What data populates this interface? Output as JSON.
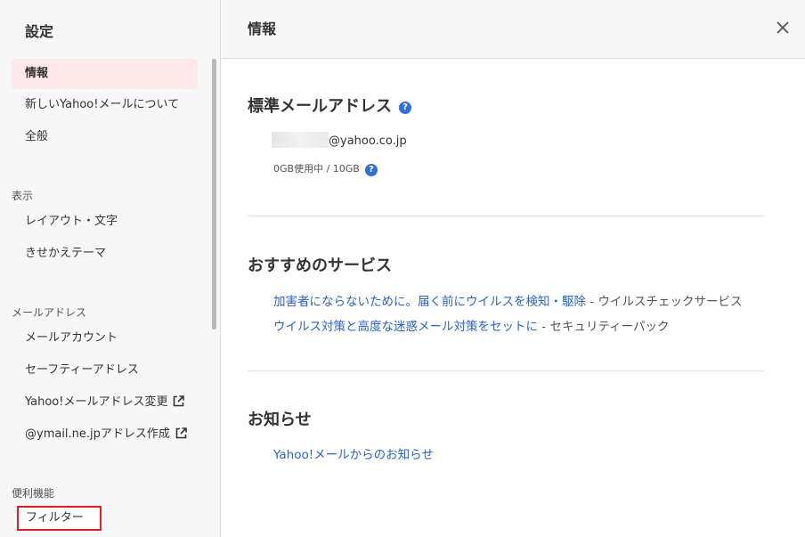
{
  "sidebar": {
    "title": "設定",
    "items_top": [
      {
        "label": "情報",
        "active": true
      },
      {
        "label": "新しいYahoo!メールについて"
      },
      {
        "label": "全般"
      }
    ],
    "sections": [
      {
        "label": "表示",
        "items": [
          "レイアウト・文字",
          "きせかえテーマ"
        ]
      },
      {
        "label": "メールアドレス",
        "items": [
          "メールアカウント",
          "セーフティーアドレス",
          "Yahoo!メールアドレス変更",
          "@ymail.ne.jpアドレス作成"
        ]
      },
      {
        "label": "便利機能",
        "items": [
          "フィルター"
        ]
      }
    ]
  },
  "main": {
    "title": "情報",
    "address_section": {
      "heading": "標準メールアドレス",
      "email_domain": "@yahoo.co.jp",
      "quota": "0GB使用中 / 10GB"
    },
    "services_section": {
      "heading": "おすすめのサービス",
      "items": [
        {
          "link": "加害者にならないために。届く前にウイルスを検知・駆除",
          "suffix": " - ウイルスチェックサービス"
        },
        {
          "link": "ウイルス対策と高度な迷惑メール対策をセットに",
          "suffix": " - セキュリティーパック"
        }
      ]
    },
    "news_section": {
      "heading": "お知らせ",
      "link": "Yahoo!メールからのお知らせ"
    }
  },
  "icons": {
    "help": "?",
    "close": "close-icon",
    "external_link": "external-link-icon"
  },
  "colors": {
    "accent_link": "#2a64c5",
    "active_bg": "#fde9e9",
    "help_icon": "#2f6fd6",
    "highlight_border": "#e02020"
  }
}
